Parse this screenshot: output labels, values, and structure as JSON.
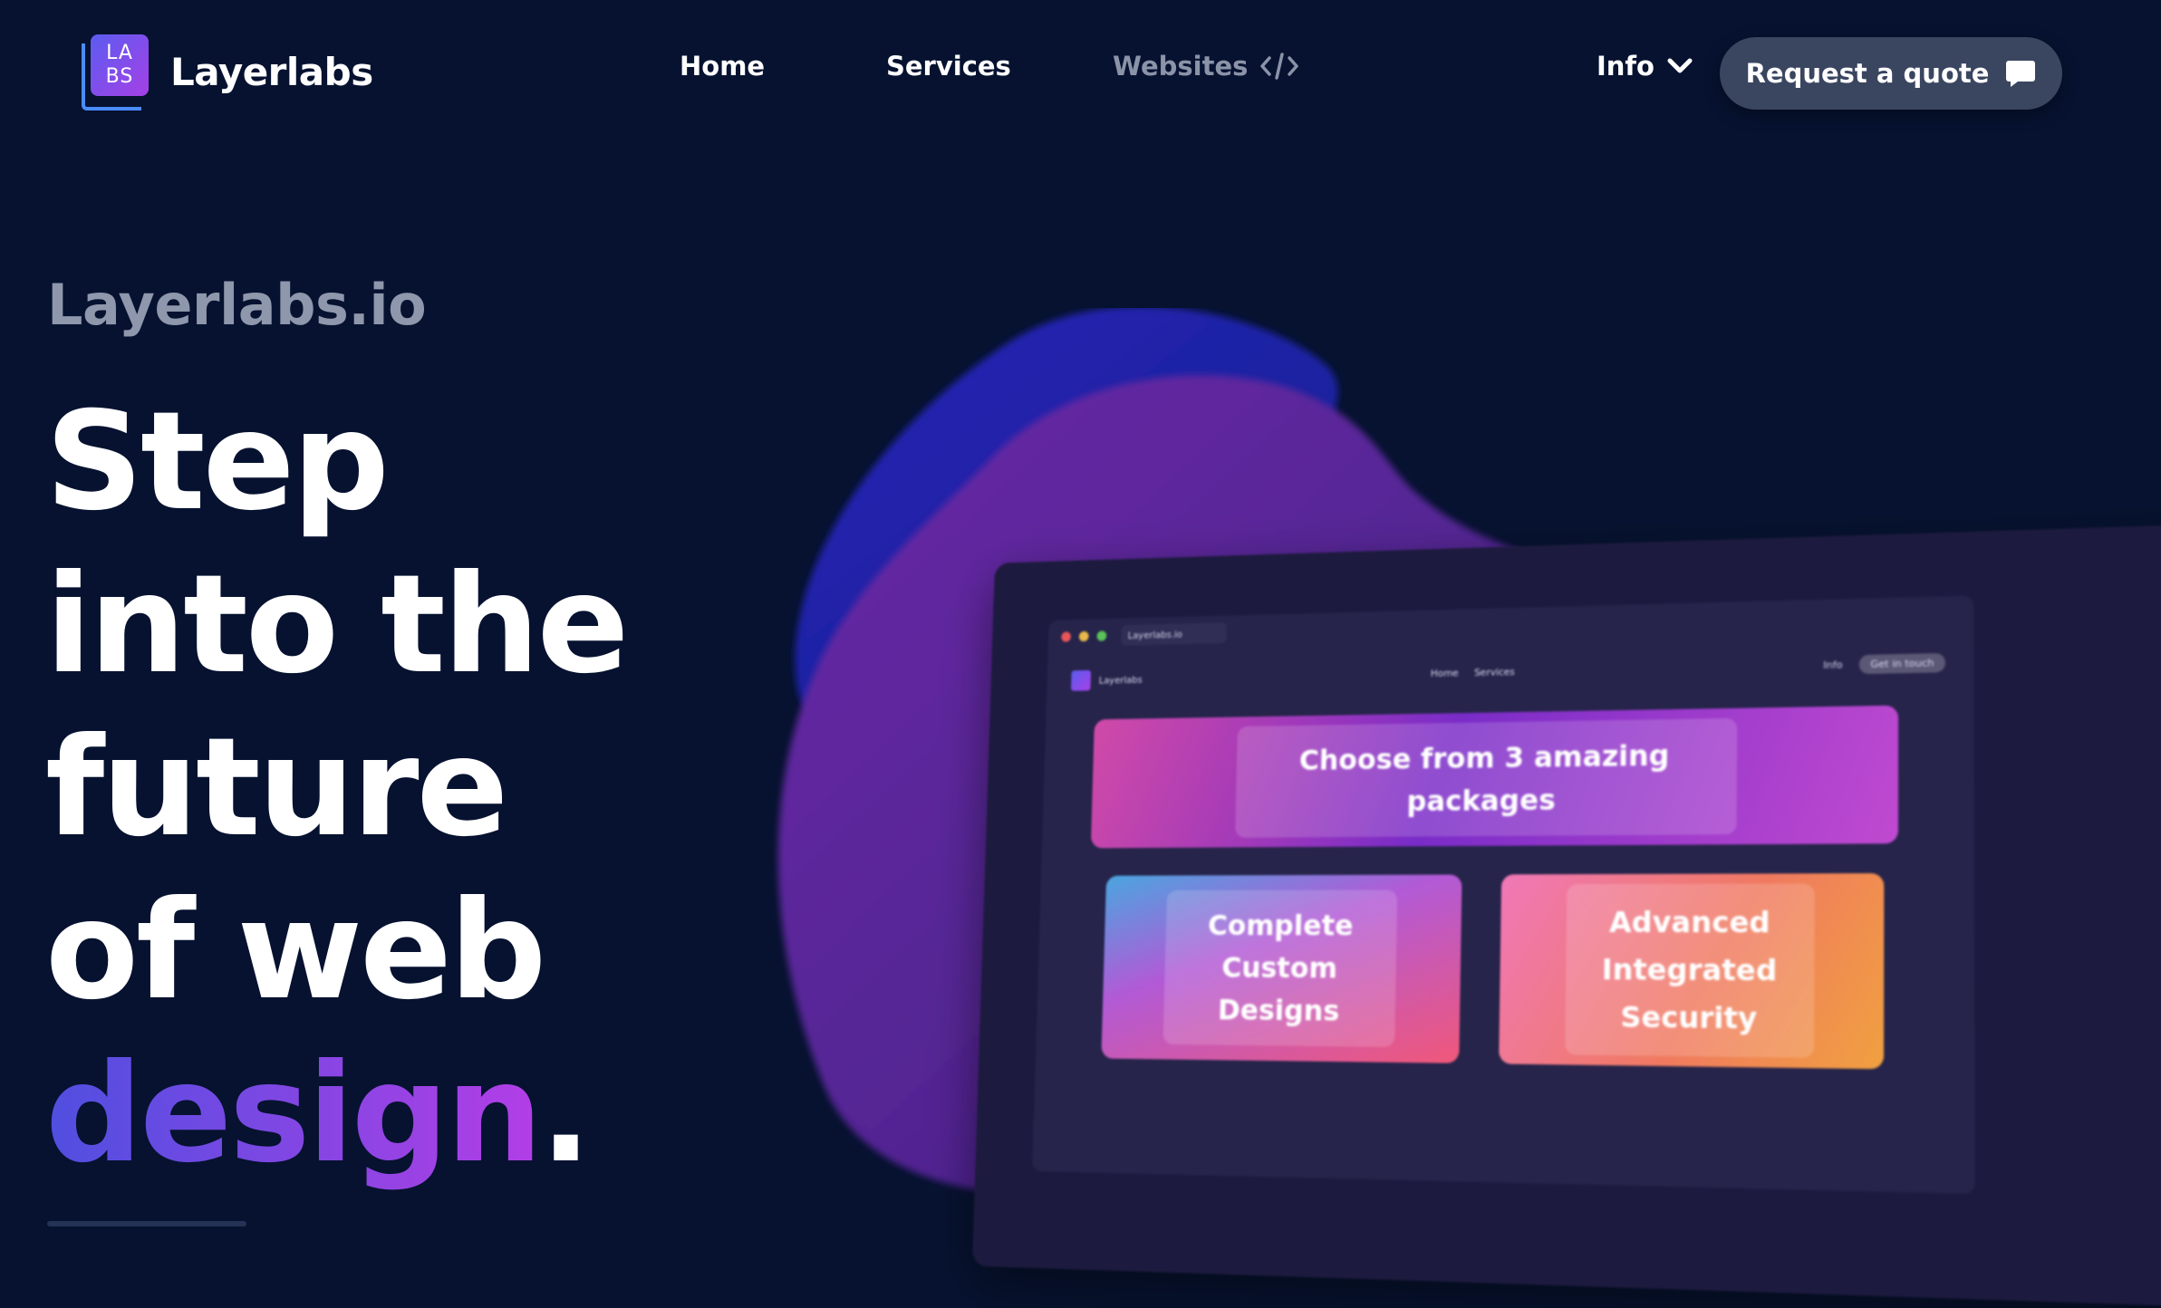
{
  "brand": {
    "logo_top": "LA",
    "logo_bottom": "BS",
    "name": "Layerlabs"
  },
  "nav": {
    "home": "Home",
    "services": "Services",
    "websites": "Websites",
    "info": "Info",
    "cta": "Request a quote"
  },
  "hero": {
    "eyebrow": "Layerlabs.io",
    "line1": "Step",
    "line2": "into the",
    "line3": "future",
    "line4": "of web",
    "highlight": "design",
    "period": "."
  },
  "mockup": {
    "tab": "Layerlabs.io",
    "nav_brand": "Layerlabs",
    "nav_home": "Home",
    "nav_services": "Services",
    "nav_info": "Info",
    "nav_cta": "Get in touch",
    "card_packages": "Choose from 3 amazing packages",
    "card_designs": "Complete Custom Designs",
    "card_security": "Advanced Integrated Security"
  },
  "colors": {
    "background": "#061230",
    "accent_start": "#4f4fe0",
    "accent_end": "#b33ee6",
    "cta_bg": "#3a4560",
    "muted_text": "#8e97ab"
  },
  "icons": {
    "code": "code-brackets-icon",
    "info_chevron": "chevron-down-icon",
    "quote": "chat-bubble-icon"
  }
}
